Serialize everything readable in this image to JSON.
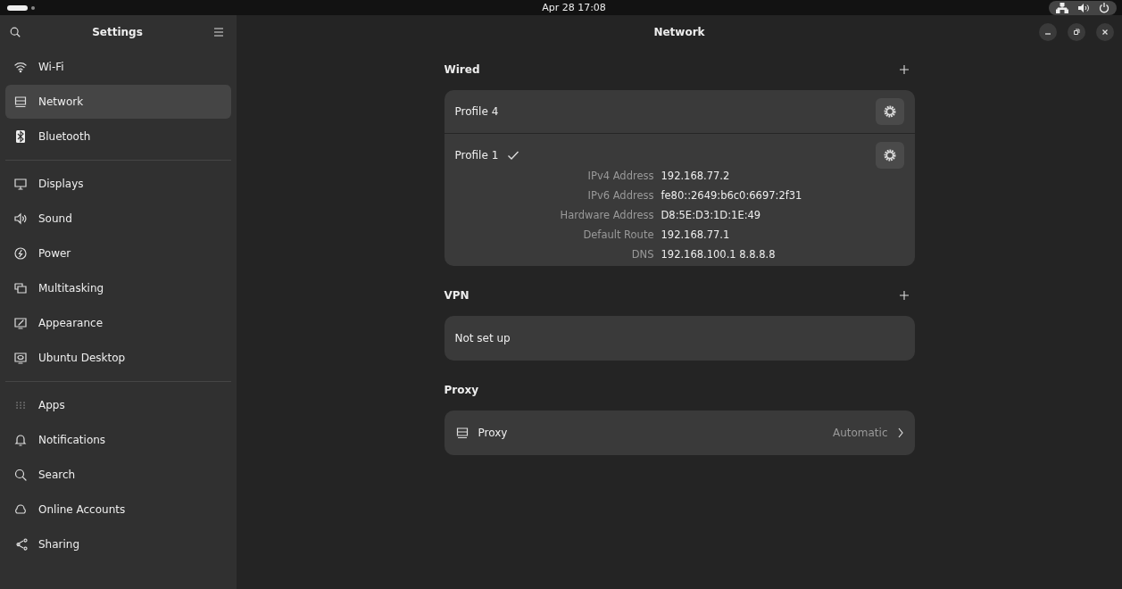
{
  "top_bar": {
    "clock": "Apr 28 17:08"
  },
  "sidebar": {
    "title": "Settings",
    "groups": [
      [
        {
          "label": "Wi-Fi",
          "selected": false
        },
        {
          "label": "Network",
          "selected": true
        },
        {
          "label": "Bluetooth",
          "selected": false
        }
      ],
      [
        {
          "label": "Displays",
          "selected": false
        },
        {
          "label": "Sound",
          "selected": false
        },
        {
          "label": "Power",
          "selected": false
        },
        {
          "label": "Multitasking",
          "selected": false
        },
        {
          "label": "Appearance",
          "selected": false
        },
        {
          "label": "Ubuntu Desktop",
          "selected": false
        }
      ],
      [
        {
          "label": "Apps",
          "selected": false
        },
        {
          "label": "Notifications",
          "selected": false
        },
        {
          "label": "Search",
          "selected": false
        },
        {
          "label": "Online Accounts",
          "selected": false
        },
        {
          "label": "Sharing",
          "selected": false
        }
      ]
    ]
  },
  "window": {
    "title": "Network"
  },
  "wired": {
    "heading": "Wired",
    "profiles": [
      {
        "name": "Profile 4",
        "active": false
      },
      {
        "name": "Profile 1",
        "active": true,
        "details": [
          {
            "label": "IPv4 Address",
            "value": "192.168.77.2"
          },
          {
            "label": "IPv6 Address",
            "value": "fe80::2649:b6c0:6697:2f31"
          },
          {
            "label": "Hardware Address",
            "value": "D8:5E:D3:1D:1E:49"
          },
          {
            "label": "Default Route",
            "value": "192.168.77.1"
          },
          {
            "label": "DNS",
            "value": "192.168.100.1 8.8.8.8"
          }
        ]
      }
    ]
  },
  "vpn": {
    "heading": "VPN",
    "status": "Not set up"
  },
  "proxy": {
    "heading": "Proxy",
    "label": "Proxy",
    "value": "Automatic"
  }
}
